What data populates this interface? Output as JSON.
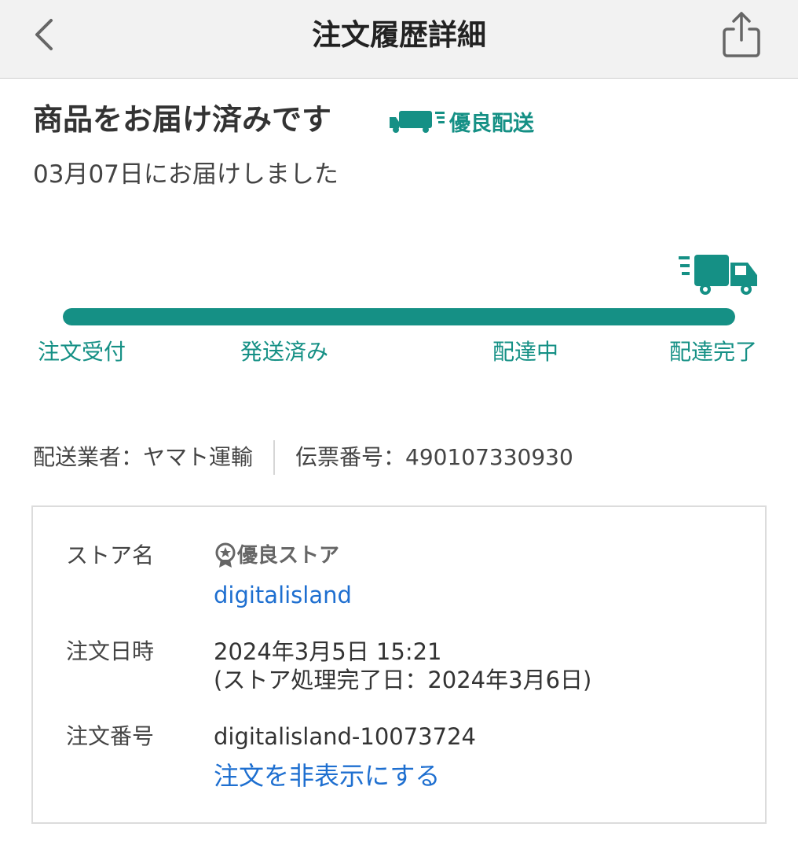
{
  "header": {
    "title": "注文履歴詳細"
  },
  "status": {
    "title": "商品をお届け済みです",
    "badge": "優良配送",
    "subtitle": "03月07日にお届けしました"
  },
  "progress": {
    "value_fraction": 1.0,
    "steps": [
      "注文受付",
      "発送済み",
      "配達中",
      "配達完了"
    ]
  },
  "shipping": {
    "carrier": "配送業者：ヤマト運輸",
    "tracking": "伝票番号：490107330930"
  },
  "order": {
    "store_label": "ストア名",
    "store_badge": "優良ストア",
    "store_name": "digitalisland",
    "date_label": "注文日時",
    "date_value": "2024年3月5日 15:21",
    "date_note": "(ストア処理完了日：2024年3月6日)",
    "number_label": "注文番号",
    "number_value": "digitalisland-10073724",
    "hide_link": "注文を非表示にする"
  },
  "colors": {
    "accent": "#159085",
    "link": "#1e6fd0"
  },
  "icons": {
    "back": "chevron-left-icon",
    "share": "share-icon",
    "badge": "delivery-truck-icon",
    "store_badge": "award-star-icon"
  }
}
